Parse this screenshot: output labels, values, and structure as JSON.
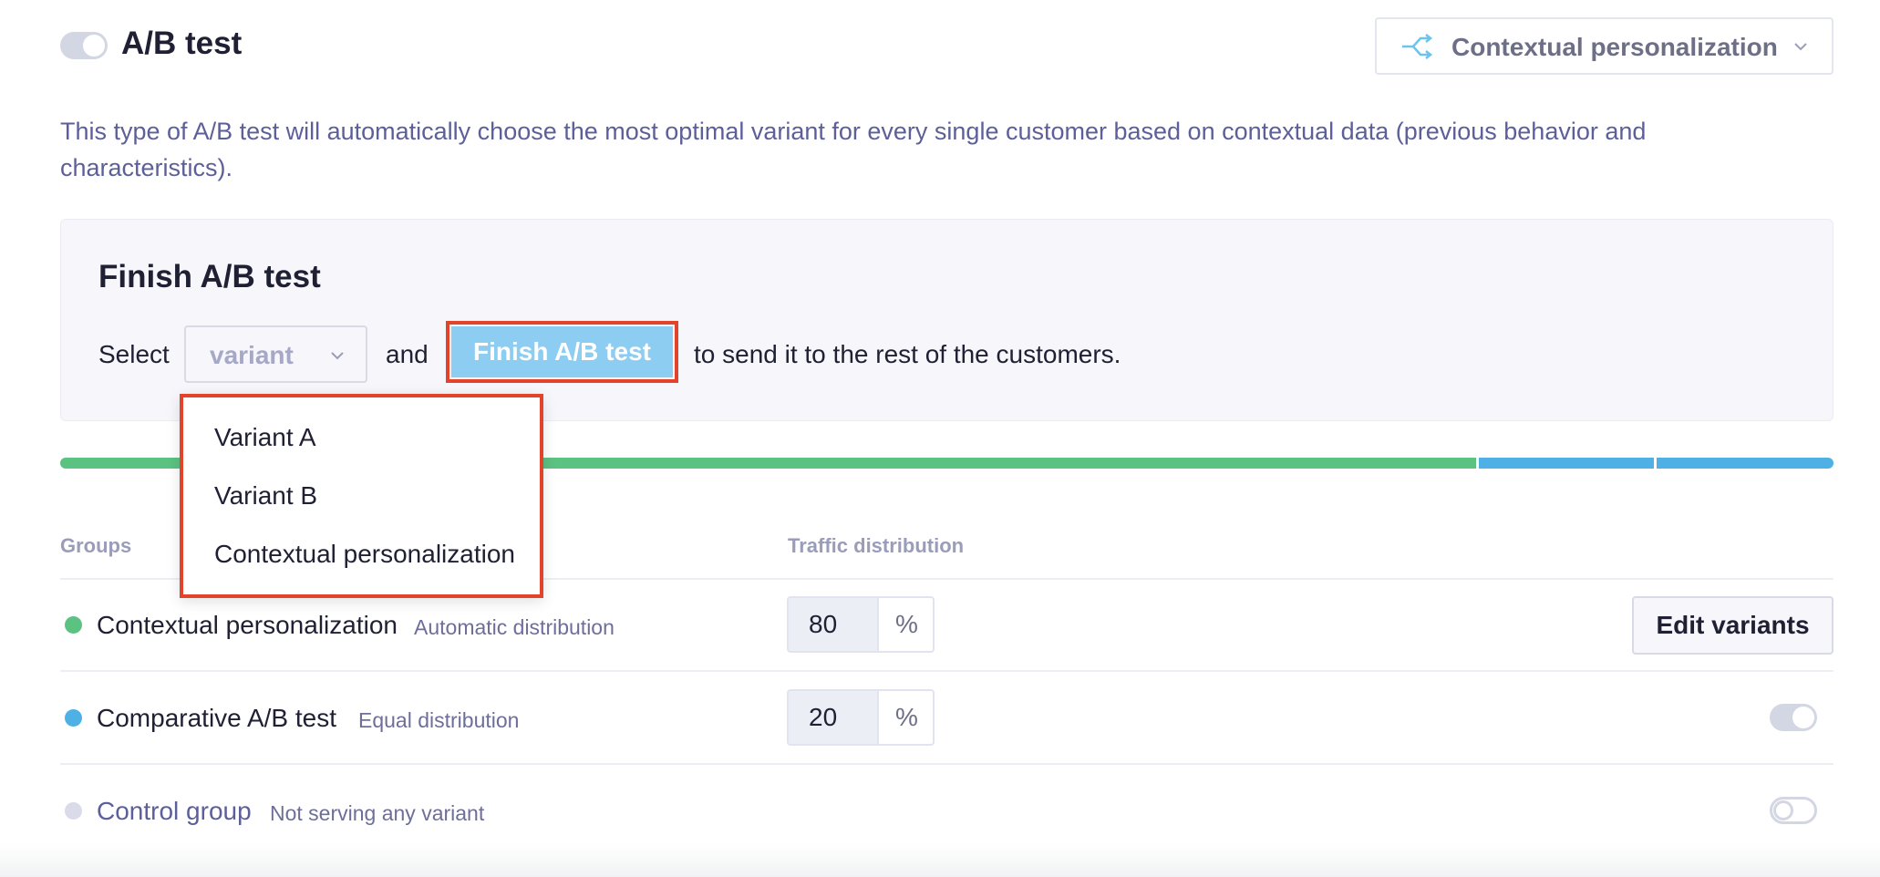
{
  "header": {
    "title": "A/B test",
    "mode_select": {
      "value": "Contextual personalization",
      "icon": "split-arrows-icon"
    }
  },
  "description": "This type of A/B test will automatically choose the most optimal variant for every single customer based on contextual data (previous behavior and characteristics).",
  "finish_panel": {
    "title": "Finish A/B test",
    "select_text": "Select",
    "variant_placeholder": "variant",
    "and_text": "and",
    "finish_button": "Finish A/B test",
    "rest_text": "to send it to the rest of the customers."
  },
  "dropdown": {
    "options": [
      "Variant A",
      "Variant B",
      "Contextual personalization"
    ]
  },
  "distribution_bar": {
    "segments": [
      {
        "group": "Contextual personalization",
        "fraction": 0.8,
        "color": "#5bc282"
      },
      {
        "group": "Comparative A/B test",
        "fraction": 0.1,
        "color": "#4fb0e6"
      },
      {
        "group": "Comparative A/B test",
        "fraction": 0.1,
        "color": "#4fb0e6"
      }
    ]
  },
  "table": {
    "headers": {
      "groups": "Groups",
      "traffic": "Traffic distribution"
    },
    "rows": [
      {
        "name": "Contextual personalization",
        "desc": "Automatic distribution",
        "value": "80",
        "unit": "%",
        "dot_color": "#5bc282"
      },
      {
        "name": "Comparative A/B test",
        "desc": "Equal distribution",
        "value": "20",
        "unit": "%",
        "dot_color": "#4fb0e6",
        "toggle": "on"
      },
      {
        "name": "Control group",
        "desc": "Not serving any variant",
        "dot_color": "#d9dbe8",
        "toggle": "off"
      }
    ],
    "edit_variants_label": "Edit variants"
  },
  "colors": {
    "accent_blue": "#4fb0e6",
    "accent_green": "#5bc282",
    "highlight_red": "#e2432b",
    "finish_button_bg": "#8ccdf1"
  }
}
